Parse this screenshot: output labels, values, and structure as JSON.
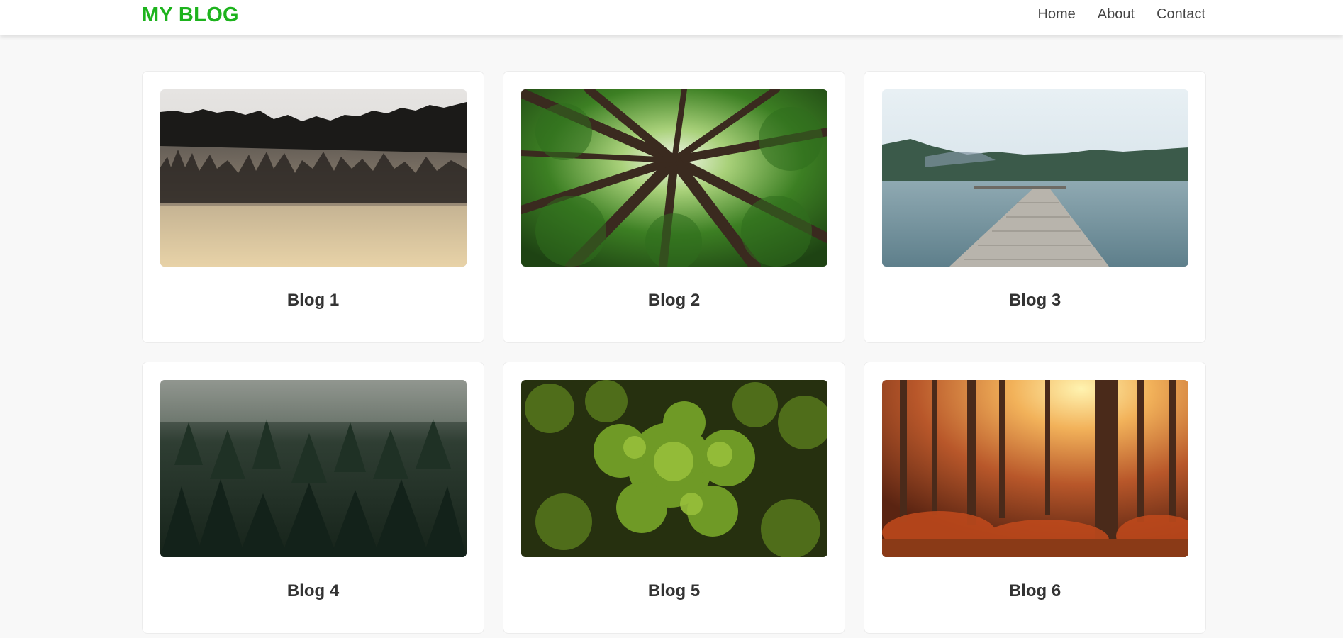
{
  "brand": {
    "logo": "MY BLOG",
    "color": "#1db31d"
  },
  "nav": {
    "items": [
      "Home",
      "About",
      "Contact"
    ]
  },
  "posts": [
    {
      "title": "Blog 1",
      "image": "misty-forest-hills"
    },
    {
      "title": "Blog 2",
      "image": "looking-up-tree-canopy"
    },
    {
      "title": "Blog 3",
      "image": "lake-wooden-pier"
    },
    {
      "title": "Blog 4",
      "image": "foggy-pine-forest"
    },
    {
      "title": "Blog 5",
      "image": "aerial-green-trees"
    },
    {
      "title": "Blog 6",
      "image": "autumn-sunlit-forest"
    }
  ]
}
